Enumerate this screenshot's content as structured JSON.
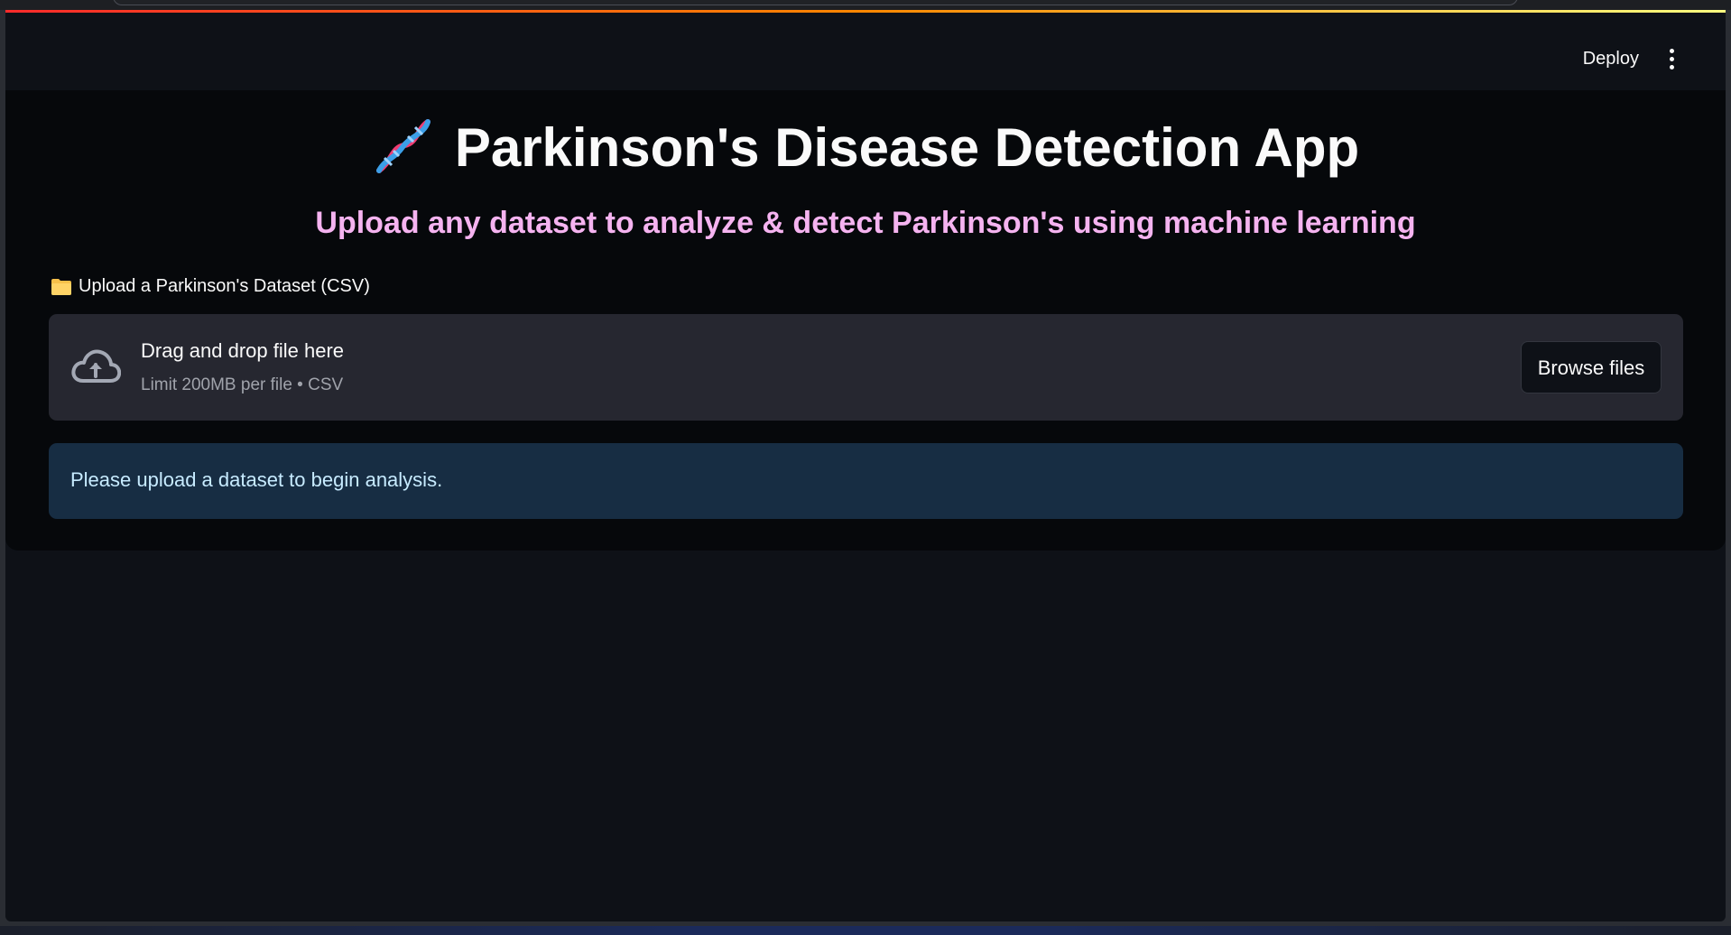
{
  "header": {
    "deploy_label": "Deploy",
    "menu_icon": "kebab-menu-icon"
  },
  "main": {
    "title_icon": "dna-icon",
    "title": "Parkinson's Disease Detection App",
    "subtitle": "Upload any dataset to analyze & detect Parkinson's using machine learning",
    "subtitle_color": "#f5b3f0"
  },
  "uploader": {
    "label_icon": "folder-icon",
    "label": "Upload a Parkinson's Dataset (CSV)",
    "dropzone_icon": "cloud-upload-icon",
    "dropzone_title": "Drag and drop file here",
    "dropzone_limit": "Limit 200MB per file • CSV",
    "browse_label": "Browse files"
  },
  "info": {
    "message": "Please upload a dataset to begin analysis.",
    "background_color": "#172d43",
    "text_color": "#c7ebff"
  },
  "colors": {
    "app_background": "#0e1117",
    "accent_gradient": [
      "#ff2b2b",
      "#ff8700",
      "#fffd80"
    ]
  }
}
